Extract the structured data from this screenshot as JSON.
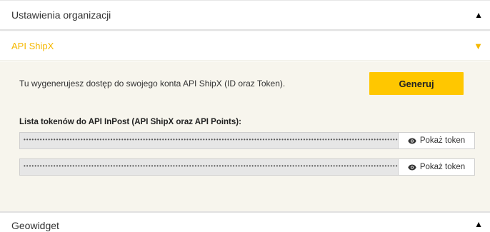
{
  "sections": {
    "org_settings": {
      "title": "Ustawienia organizacji",
      "arrow": "▲"
    },
    "api_shipx": {
      "title": "API ShipX",
      "arrow": "▼"
    },
    "geowidget": {
      "title": "Geowidget",
      "arrow": "▲"
    }
  },
  "panel": {
    "intro_text": "Tu wygenerujesz dostęp do swojego konta API ShipX (ID oraz Token).",
    "generate_label": "Generuj",
    "tokens_label": "Lista tokenów do API InPost (API ShipX oraz API Points):",
    "tokens": [
      {
        "masked": "••••••••••••••••••••••••••••••••••••••••••••••••••••••••••••••••••••••••••••••••••••••••••••••••••••••••••••••••••••••••••••••••••••••••••••••••••••••••••••••••••••••••••••",
        "show_label": "Pokaż token"
      },
      {
        "masked": "••••••••••••••••••••••••••••••••••••••••••••••••••••••••••••••••••••••••••••••••••••••••••••••••••••••••••••••••••••••••••••••••••••••••••••••••••••••••••••••••••••••••••••",
        "show_label": "Pokaż token"
      }
    ]
  },
  "colors": {
    "accent": "#ffc700",
    "active_title": "#f5b800",
    "panel_bg": "#f7f5ed"
  },
  "icons": {
    "expand": "arrow-up-icon",
    "collapse": "arrow-down-icon",
    "show": "eye-icon"
  }
}
